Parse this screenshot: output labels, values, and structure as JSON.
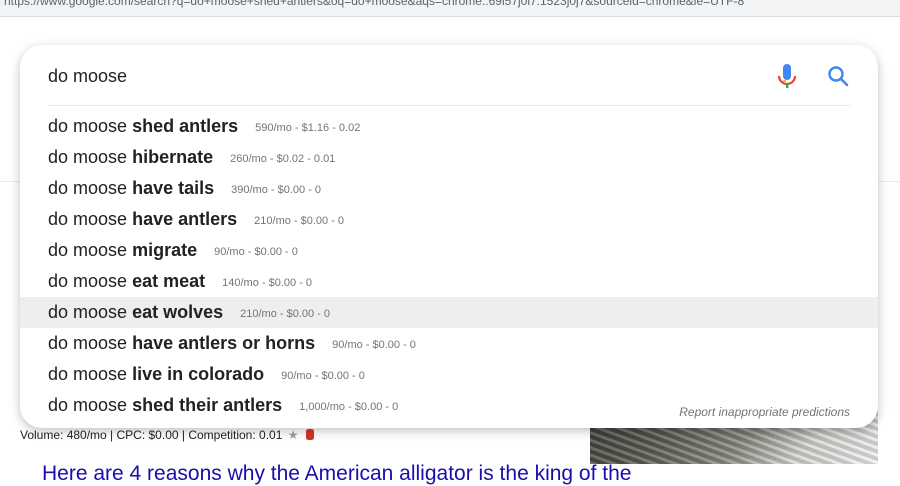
{
  "browser": {
    "url_fragment": "https://www.google.com/search?q=do+moose+shed+antlers&oq=do+moose&aqs=chrome..69i57j0l7.1523j0j7&sourceid=chrome&ie=UTF-8"
  },
  "search": {
    "query": "do moose",
    "mic_icon": "microphone-icon",
    "search_icon": "magnifier-icon"
  },
  "suggestions": [
    {
      "prefix": "do moose",
      "completion": "shed antlers",
      "meta": "590/mo - $1.16 - 0.02"
    },
    {
      "prefix": "do moose",
      "completion": "hibernate",
      "meta": "260/mo - $0.02 - 0.01"
    },
    {
      "prefix": "do moose",
      "completion": "have tails",
      "meta": "390/mo - $0.00 - 0"
    },
    {
      "prefix": "do moose",
      "completion": "have antlers",
      "meta": "210/mo - $0.00 - 0"
    },
    {
      "prefix": "do moose",
      "completion": "migrate",
      "meta": "90/mo - $0.00 - 0"
    },
    {
      "prefix": "do moose",
      "completion": "eat meat",
      "meta": "140/mo - $0.00 - 0"
    },
    {
      "prefix": "do moose",
      "completion": "eat wolves",
      "meta": "210/mo - $0.00 - 0"
    },
    {
      "prefix": "do moose",
      "completion": "have antlers or horns",
      "meta": "90/mo - $0.00 - 0"
    },
    {
      "prefix": "do moose",
      "completion": "live in colorado",
      "meta": "90/mo - $0.00 - 0"
    },
    {
      "prefix": "do moose",
      "completion": "shed their antlers",
      "meta": "1,000/mo - $0.00 - 0"
    }
  ],
  "highlighted_index": 6,
  "report_link": "Report inappropriate predictions",
  "result": {
    "meta": "Volume: 480/mo | CPC: $0.00 | Competition: 0.01",
    "star": "★",
    "title": "Here are 4 reasons why the American alligator is the king of the"
  },
  "colors": {
    "link": "#1a0dab",
    "mic_blue": "#4285f4",
    "mic_red": "#ea4335",
    "mic_yellow": "#fbbc04",
    "mic_green": "#34a853"
  }
}
